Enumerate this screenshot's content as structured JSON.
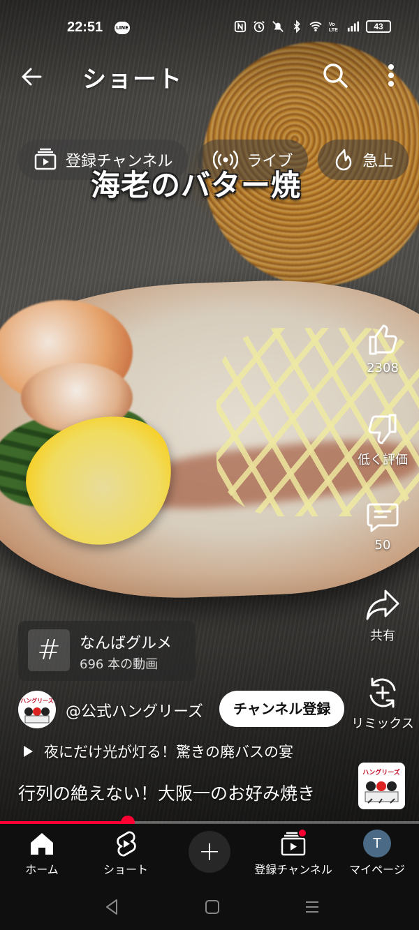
{
  "status_bar": {
    "time": "22:51",
    "line_badge": "LINE",
    "icons": [
      "nfc-icon",
      "alarm-icon",
      "mute-icon",
      "bluetooth-icon",
      "wifi-icon",
      "volte-icon",
      "signal-icon"
    ],
    "battery": "43"
  },
  "header": {
    "title": "ショート"
  },
  "chips": [
    {
      "label": "登録チャンネル",
      "icon": "subscriptions-icon"
    },
    {
      "label": "ライブ",
      "icon": "live-icon"
    },
    {
      "label": "急上",
      "icon": "trending-icon"
    }
  ],
  "overlay_caption": "海老のバター焼",
  "actions": {
    "like_count": "2308",
    "dislike_label": "低く評価",
    "comment_count": "50",
    "share_label": "共有",
    "remix_label": "リミックス"
  },
  "hashtag": {
    "symbol": "#",
    "name": "なんばグルメ",
    "count": "696 本の動画"
  },
  "channel": {
    "name": "@公式ハングリーズ",
    "subscribe_label": "チャンネル登録",
    "avatar_text": "ハングリーズ"
  },
  "music": {
    "title": "夜にだけ光が灯る！驚きの廃バスの宴"
  },
  "video": {
    "title": "行列の絶えない！大阪一のお好み焼き",
    "progress": 0.305
  },
  "bottom_nav": {
    "items": [
      {
        "label": "ホーム",
        "icon": "home-icon"
      },
      {
        "label": "ショート",
        "icon": "shorts-icon"
      },
      {
        "label": "",
        "icon": "create-icon"
      },
      {
        "label": "登録チャンネル",
        "icon": "subscriptions-icon"
      },
      {
        "label": "マイページ",
        "icon": "avatar"
      }
    ],
    "avatar_letter": "T"
  },
  "colors": {
    "accent": "#ff0033",
    "nav_bg": "#0f0f0f"
  }
}
